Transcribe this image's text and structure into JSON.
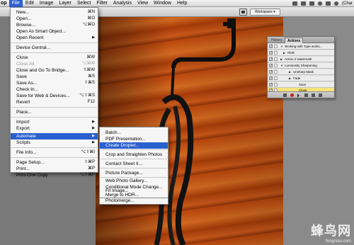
{
  "menubar": {
    "app_fragment": "op",
    "items": [
      "File",
      "Edit",
      "Image",
      "Layer",
      "Select",
      "Filter",
      "Analysis",
      "View",
      "Window",
      "Help"
    ],
    "active": "File",
    "right_text": "(Char"
  },
  "optionsbar": {
    "workspace_label": "Workspace ▾"
  },
  "file_menu": {
    "items": [
      {
        "label": "New...",
        "shortcut": "⌘N",
        "disabled": false
      },
      {
        "label": "Open...",
        "shortcut": "⌘O",
        "disabled": false
      },
      {
        "label": "Browse...",
        "shortcut": "⌥⌘O",
        "disabled": false
      },
      {
        "label": "Open As Smart Object...",
        "shortcut": "",
        "disabled": false
      },
      {
        "label": "Open Recent",
        "shortcut": "",
        "disabled": false,
        "submenu": true
      },
      {
        "label": "Device Central...",
        "shortcut": "",
        "disabled": false
      },
      {
        "label": "Close",
        "shortcut": "⌘W",
        "disabled": false
      },
      {
        "label": "Close All",
        "shortcut": "⌥⌘W",
        "disabled": true
      },
      {
        "label": "Close and Go To Bridge...",
        "shortcut": "⇧⌘W",
        "disabled": false
      },
      {
        "label": "Save",
        "shortcut": "⌘S",
        "disabled": false
      },
      {
        "label": "Save As...",
        "shortcut": "⇧⌘S",
        "disabled": false
      },
      {
        "label": "Check In...",
        "shortcut": "",
        "disabled": false
      },
      {
        "label": "Save for Web & Devices...",
        "shortcut": "⌥⇧⌘S",
        "disabled": false
      },
      {
        "label": "Revert",
        "shortcut": "F12",
        "disabled": false
      },
      {
        "label": "Place...",
        "shortcut": "",
        "disabled": false
      },
      {
        "label": "Import",
        "shortcut": "",
        "disabled": false,
        "submenu": true
      },
      {
        "label": "Export",
        "shortcut": "",
        "disabled": false,
        "submenu": true
      },
      {
        "label": "Automate",
        "shortcut": "",
        "disabled": false,
        "submenu": true,
        "selected": true
      },
      {
        "label": "Scripts",
        "shortcut": "",
        "disabled": false,
        "submenu": true
      },
      {
        "label": "File Info...",
        "shortcut": "⌥⇧⌘I",
        "disabled": false
      },
      {
        "label": "Page Setup...",
        "shortcut": "⇧⌘P",
        "disabled": false
      },
      {
        "label": "Print...",
        "shortcut": "⌘P",
        "disabled": false
      },
      {
        "label": "Print One Copy",
        "shortcut": "⌥⇧⌘P",
        "disabled": false
      }
    ]
  },
  "automate_menu": {
    "items": [
      {
        "label": "Batch...",
        "selected": false
      },
      {
        "label": "PDF Presentation...",
        "selected": false
      },
      {
        "label": "Create Droplet...",
        "selected": true
      },
      {
        "label": "Crop and Straighten Photos",
        "selected": false
      },
      {
        "label": "Contact Sheet II...",
        "selected": false
      },
      {
        "label": "Picture Package...",
        "selected": false
      },
      {
        "label": "Web Photo Gallery...",
        "selected": false
      },
      {
        "label": "Conditional Mode Change...",
        "selected": false
      },
      {
        "label": "Fit Image...",
        "selected": false
      },
      {
        "label": "Merge to HDR...",
        "selected": false
      },
      {
        "label": "Photomerge...",
        "selected": false
      }
    ]
  },
  "actions_panel": {
    "tabs": [
      "History",
      "Actions"
    ],
    "active_tab": "Actions",
    "rows": [
      {
        "label": "Working with Type works...",
        "indent": 0,
        "checked": true
      },
      {
        "label": "RGB",
        "indent": 1,
        "checked": true
      },
      {
        "label": "Action 2 watermark",
        "indent": 0,
        "checked": true
      },
      {
        "label": "Luminosity Sharpening",
        "indent": 0,
        "checked": true
      },
      {
        "label": "Unsharp Mask",
        "indent": 1,
        "checked": true
      },
      {
        "label": "Fade",
        "indent": 1,
        "checked": true
      },
      {
        "label": "Save",
        "indent": 2,
        "checked": true
      },
      {
        "label": "Close",
        "indent": 2,
        "checked": true,
        "highlight": true
      }
    ]
  },
  "watermark": {
    "cn": "蜂鸟网",
    "url": "fengniao.com"
  }
}
